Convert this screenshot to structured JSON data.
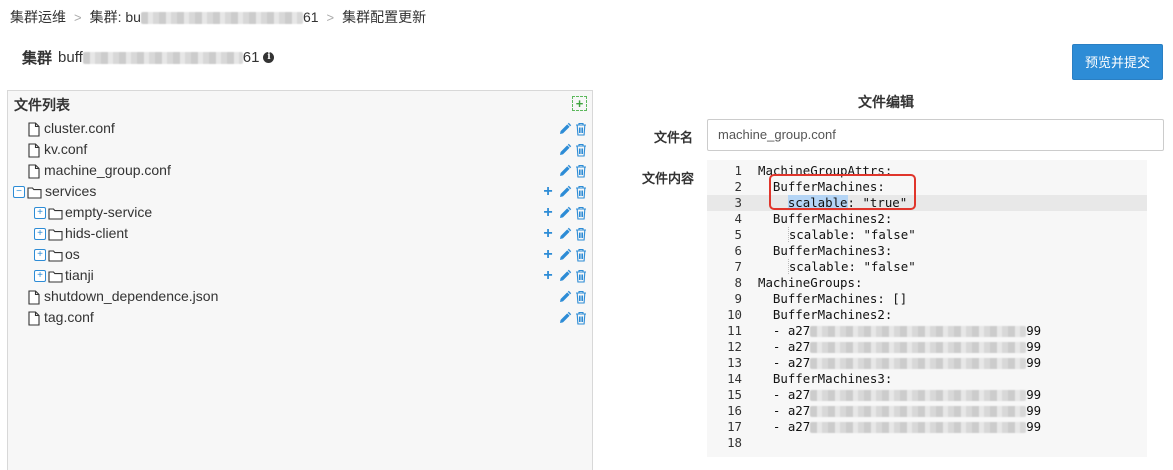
{
  "breadcrumb": {
    "root": "集群运维",
    "cluster_prefix": "集群: bu",
    "cluster_suffix": "61",
    "current": "集群配置更新",
    "separator": ">"
  },
  "header": {
    "title_label": "集群",
    "cluster_name_prefix": "buff",
    "cluster_name_suffix": "61",
    "info_icon": "i",
    "preview_submit_button": "预览并提交"
  },
  "file_list": {
    "title": "文件列表",
    "add_icon": "+",
    "items": [
      {
        "name": "cluster.conf",
        "type": "file"
      },
      {
        "name": "kv.conf",
        "type": "file"
      },
      {
        "name": "machine_group.conf",
        "type": "file"
      },
      {
        "name": "services",
        "type": "folder",
        "expanded": true
      },
      {
        "name": "empty-service",
        "type": "folder",
        "expanded": false
      },
      {
        "name": "hids-client",
        "type": "folder",
        "expanded": false
      },
      {
        "name": "os",
        "type": "folder",
        "expanded": false
      },
      {
        "name": "tianji",
        "type": "folder",
        "expanded": false
      },
      {
        "name": "shutdown_dependence.json",
        "type": "file"
      },
      {
        "name": "tag.conf",
        "type": "file"
      }
    ],
    "expander_expanded": "−",
    "expander_collapsed": "+",
    "add_child": "+"
  },
  "editor": {
    "heading": "文件编辑",
    "filename_label": "文件名",
    "filename_value": "machine_group.conf",
    "content_label": "文件内容",
    "active_line": 3,
    "lines": [
      {
        "n": "1",
        "text": "MachineGroupAttrs:"
      },
      {
        "n": "2",
        "text": "  BufferMachines:"
      },
      {
        "n": "3",
        "indent": "    ",
        "key": "scalable",
        "rest": ": \"true\""
      },
      {
        "n": "4",
        "text": "  BufferMachines2:"
      },
      {
        "n": "5",
        "indent": "    ",
        "key": "scalable",
        "rest": ": \"false\""
      },
      {
        "n": "6",
        "text": "  BufferMachines3:"
      },
      {
        "n": "7",
        "indent": "    ",
        "key": "scalable",
        "rest": ": \"false\""
      },
      {
        "n": "8",
        "text": "MachineGroups:"
      },
      {
        "n": "9",
        "text": "  BufferMachines: []"
      },
      {
        "n": "10",
        "text": "  BufferMachines2:"
      },
      {
        "n": "11",
        "prefix": "  - a27",
        "suffix": "99"
      },
      {
        "n": "12",
        "prefix": "  - a27",
        "suffix": "99"
      },
      {
        "n": "13",
        "prefix": "  - a27",
        "suffix": "99"
      },
      {
        "n": "14",
        "text": "  BufferMachines3:"
      },
      {
        "n": "15",
        "prefix": "  - a27",
        "suffix": "99"
      },
      {
        "n": "16",
        "prefix": "  - a27",
        "suffix": "99"
      },
      {
        "n": "17",
        "prefix": "  - a27",
        "suffix": "99"
      },
      {
        "n": "18",
        "text": ""
      }
    ]
  }
}
